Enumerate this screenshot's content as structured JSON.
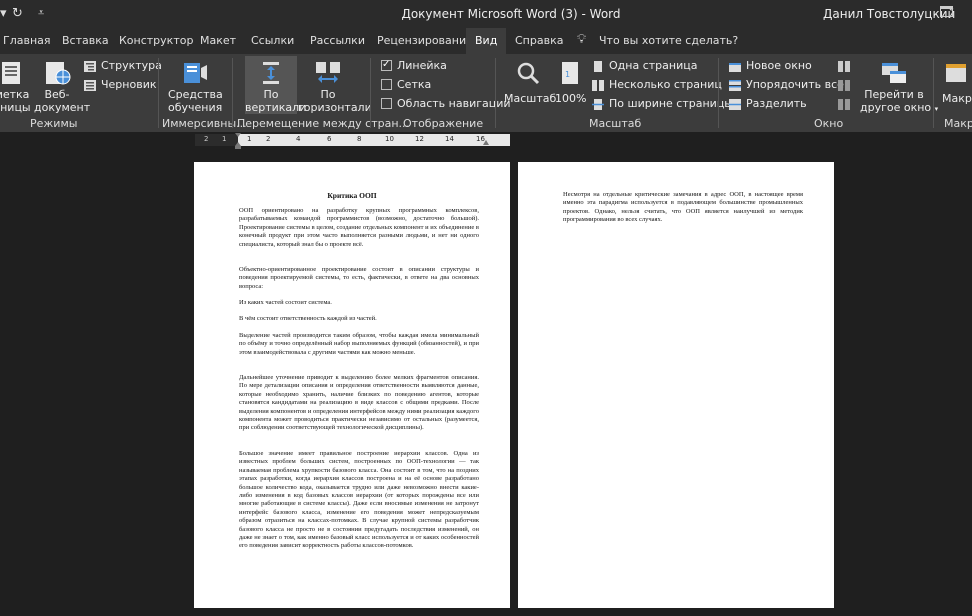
{
  "window": {
    "title": "Документ Microsoft Word (3)  -  Word",
    "user": "Данил Товстолуцкий"
  },
  "tabs": [
    {
      "label": "Главная"
    },
    {
      "label": "Вставка"
    },
    {
      "label": "Конструктор"
    },
    {
      "label": "Макет"
    },
    {
      "label": "Ссылки"
    },
    {
      "label": "Рассылки"
    },
    {
      "label": "Рецензирование"
    },
    {
      "label": "Вид",
      "active": true
    },
    {
      "label": "Справка"
    },
    {
      "label": "Что вы хотите сделать?"
    }
  ],
  "ribbon": {
    "modes": {
      "markup_line1": "метка",
      "markup_line2": "аницы",
      "web_line1": "Веб-",
      "web_line2": "документ",
      "structure": "Структура",
      "draft": "Черновик",
      "group": "Режимы"
    },
    "immersive": {
      "tools_line1": "Средства",
      "tools_line2": "обучения",
      "group": "Иммерсивны..."
    },
    "page_move": {
      "vertical_line1": "По",
      "vertical_line2": "вертикали",
      "horizontal_line1": "По",
      "horizontal_line2": "горизонтали",
      "group": "Перемещение между стран..."
    },
    "show": {
      "ruler": "Линейка",
      "ruler_checked": true,
      "grid": "Сетка",
      "grid_checked": false,
      "nav": "Область навигации",
      "nav_checked": false,
      "group": "Отображение"
    },
    "zoom": {
      "zoom": "Масштаб",
      "percent": "100%",
      "one_page": "Одна страница",
      "multi_page": "Несколько страниц",
      "page_width": "По ширине страницы",
      "group": "Масштаб"
    },
    "window": {
      "new_window": "Новое окно",
      "arrange_all": "Упорядочить все",
      "split": "Разделить",
      "switch_line1": "Перейти в",
      "switch_line2": "другое окно",
      "group": "Окно"
    },
    "macros": {
      "label": "Макро",
      "group": "Макро"
    }
  },
  "ruler": {
    "left_ticks": [
      "2",
      "1"
    ],
    "ticks": [
      "1",
      "2",
      "4",
      "6",
      "8",
      "10",
      "12",
      "14",
      "16"
    ]
  },
  "document": {
    "page1": {
      "title": "Критика ООП",
      "paragraphs": [
        "ООП ориентировано на разработку крупных программных комплексов, разрабатываемых командой программистов (возможно, достаточно большой). Проектирование системы в целом, создание отдельных компонент и их объединение в конечный продукт при этом часто выполняется разными людьми, и нет ни одного специалиста, который знал бы о проекте всё.",
        "Объектно-ориентированное проектирование состоит в описании структуры и поведения проектируемой системы, то есть, фактически, в ответе на два основных вопроса:",
        "Из каких частей состоит система.",
        "В чём состоит ответственность каждой из частей.",
        "Выделение частей производится таким образом, чтобы каждая имела минимальный по объёму и точно определённый набор выполняемых функций (обязанностей), и при этом взаимодействовала с другими частями как можно меньше.",
        "Дальнейшее уточнение приводит к выделению более мелких фрагментов описания. По мере детализации описания и определения ответственности выявляются данные, которые необходимо хранить, наличие близких по поведению агентов, которые становятся кандидатами на реализацию в виде классов с общими предками. После выделения компонентов и определения интерфейсов между ними реализация каждого компонента может проводиться практически независимо от остальных (разумеется, при соблюдении соответствующей технологической дисциплины).",
        "Большое значение имеет правильное построение иерархии классов. Одна из известных проблем больших систем, построенных по ООП-технологии — так называемая проблема хрупкости базового класса. Она состоит в том, что на поздних этапах разработки, когда иерархия классов построена и на её основе разработано большое количество кода, оказывается трудно или даже невозможно внести какие-либо изменения в код базовых классов иерархии (от которых порождены все или многие работающие в системе классы). Даже если вносимые изменения не затронут интерфейс базового класса, изменение его поведения может непредсказуемым образом отразиться на классах-потомках. В случае крупной системы разработчик базового класса не просто не в состоянии предугадать последствия изменений, он даже не знает о том, как именно базовый класс используется и от каких особенностей его поведения зависит корректность работы классов-потомков."
      ]
    },
    "page2": {
      "paragraphs": [
        "Несмотря на отдельные критические замечания в адрес ООП, в настоящее время именно эта парадигма используется в подавляющем большинстве промышленных проектов. Однако, нельзя считать, что ООП является наилучшей из методик программирования во всех случаях."
      ]
    }
  }
}
